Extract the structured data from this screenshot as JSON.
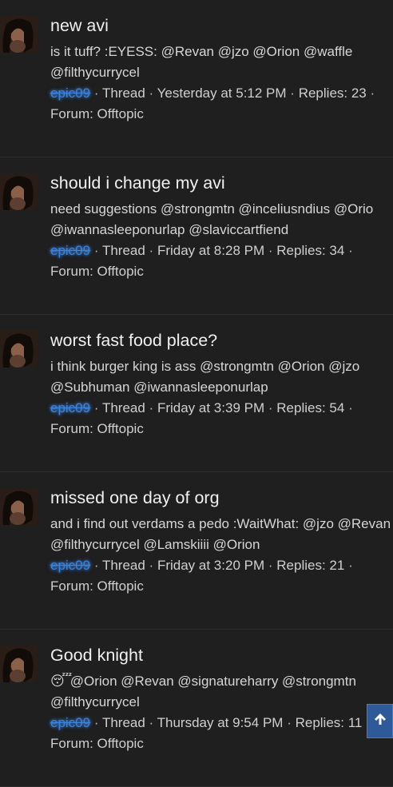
{
  "threads": [
    {
      "title": "new avi",
      "snippet": "is it tuff? :EYESS: @Revan @jzo @Orion @waffle @filthycurrycel",
      "emoji": "",
      "user": "epic09",
      "type": "Thread",
      "time": "Yesterday at 5:12 PM",
      "replies": "Replies: 23",
      "forum": "Forum: Offtopic"
    },
    {
      "title": "should i change my avi",
      "snippet": "need suggestions @strongmtn @inceliusndius @Orio @iwannasleeponurlap @slaviccartfiend",
      "emoji": "",
      "user": "epic09",
      "type": "Thread",
      "time": "Friday at 8:28 PM",
      "replies": "Replies: 34",
      "forum": "Forum: Offtopic"
    },
    {
      "title": "worst fast food place?",
      "snippet": "i think burger king is ass @strongmtn @Orion @jzo @Subhuman @iwannasleeponurlap",
      "emoji": "",
      "user": "epic09",
      "type": "Thread",
      "time": "Friday at 3:39 PM",
      "replies": "Replies: 54",
      "forum": "Forum: Offtopic"
    },
    {
      "title": "missed one day of org",
      "snippet": "and i find out verdams a pedo :WaitWhat: @jzo @Revan @filthycurrycel @Lamskiiii @Orion",
      "emoji": "",
      "user": "epic09",
      "type": "Thread",
      "time": "Friday at 3:20 PM",
      "replies": "Replies: 21",
      "forum": "Forum: Offtopic"
    },
    {
      "title": "Good knight",
      "snippet": "@Orion @Revan @signatureharry @strongmtn @filthycurrycel",
      "emoji": "😴",
      "user": "epic09",
      "type": "Thread",
      "time": "Thursday at 9:54 PM",
      "replies": "Replies: 11",
      "forum": "Forum: Offtopic"
    }
  ],
  "separator": "·",
  "scroll_top_icon": "arrow-up-icon",
  "colors": {
    "background": "#1f1f1f",
    "username": "#3b82d8",
    "scroll_button": "#2f5a9a"
  }
}
